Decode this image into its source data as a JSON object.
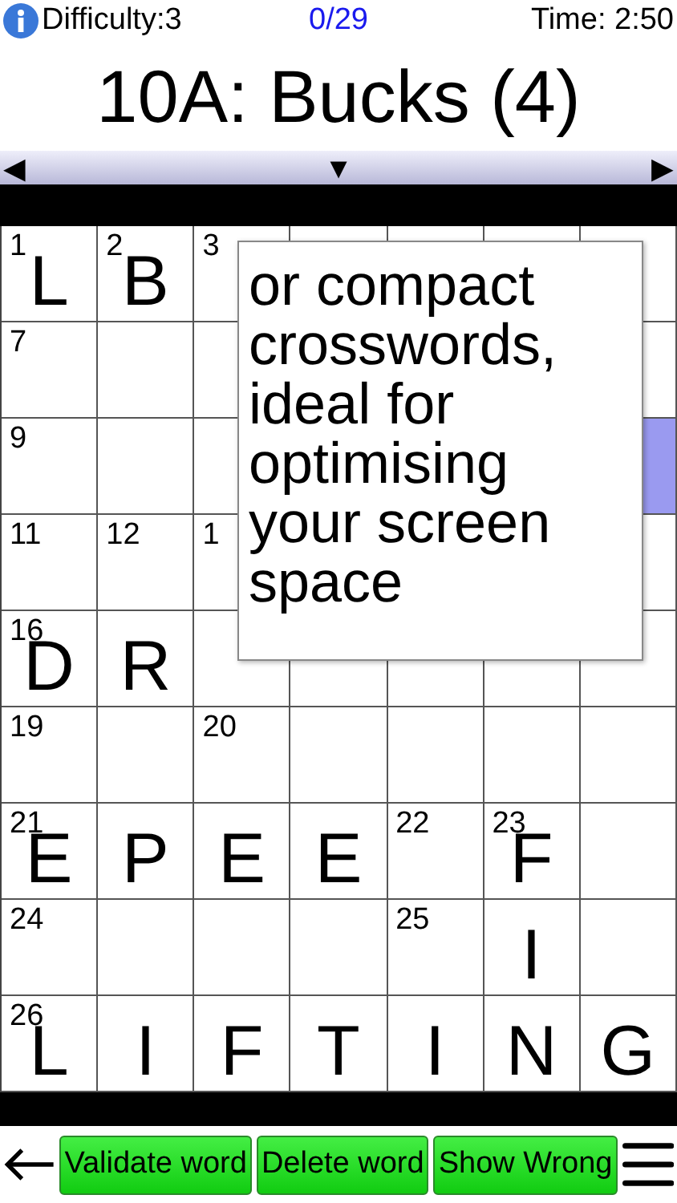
{
  "status": {
    "difficulty": "Difficulty:3",
    "progress": "0/29",
    "time": "Time: 2:50"
  },
  "clue": "10A: Bucks (4)",
  "nav": {
    "prev": "◀",
    "down": "▼",
    "next": "▶"
  },
  "grid": [
    [
      {
        "number": "1",
        "letter": "L",
        "selected": false
      },
      {
        "number": "2",
        "letter": "B",
        "selected": false
      },
      {
        "number": "3",
        "selected": false
      },
      {
        "selected": false
      }
    ],
    [
      {
        "number": "7",
        "selected": false
      },
      {
        "selected": false
      },
      {
        "selected": false
      },
      {
        "selected": false
      }
    ],
    [
      {
        "number": "9",
        "selected": false
      },
      {
        "selected": false
      },
      {
        "selected": false
      },
      {
        "selected": true
      }
    ],
    [
      {
        "number": "11",
        "selected": false
      },
      {
        "number": "12",
        "selected": false
      },
      {
        "number": "1",
        "selected": false
      },
      {
        "selected": false
      }
    ],
    [
      {
        "number": "16",
        "letter": "D",
        "selected": false
      },
      {
        "letter": "R",
        "selected": false
      },
      {
        "selected": false
      },
      {
        "selected": false
      },
      {
        "selected": false
      },
      {
        "selected": false
      },
      {
        "selected": false
      }
    ],
    [
      {
        "number": "19",
        "selected": false
      },
      {
        "selected": false
      },
      {
        "number": "20",
        "selected": false
      },
      {
        "selected": false
      },
      {
        "selected": false
      },
      {
        "selected": false
      },
      {
        "selected": false
      }
    ],
    [
      {
        "number": "21",
        "letter": "E",
        "selected": false
      },
      {
        "letter": "P",
        "selected": false
      },
      {
        "letter": "E",
        "selected": false
      },
      {
        "letter": "E",
        "selected": false
      },
      {
        "number": "22",
        "selected": false
      },
      {
        "number": "23",
        "letter": "F",
        "selected": false
      },
      {
        "selected": false
      }
    ],
    [
      {
        "number": "24",
        "selected": false
      },
      {
        "selected": false
      },
      {
        "selected": false
      },
      {
        "selected": false
      },
      {
        "number": "25",
        "selected": false
      },
      {
        "letter": "I",
        "selected": false
      },
      {
        "selected": false
      }
    ],
    [
      {
        "number": "26",
        "letter": "L",
        "selected": false
      },
      {
        "letter": "I",
        "selected": false
      },
      {
        "letter": "F",
        "selected": false
      },
      {
        "letter": "T",
        "selected": false
      },
      {
        "letter": "I",
        "selected": false
      },
      {
        "letter": "N",
        "selected": false
      },
      {
        "letter": "G",
        "selected": false
      }
    ]
  ],
  "popup": "or compact crosswords, ideal for optimising your screen space",
  "toolbar": {
    "buttons": [
      "Validate word",
      "Delete word",
      "Show Wrong"
    ]
  }
}
